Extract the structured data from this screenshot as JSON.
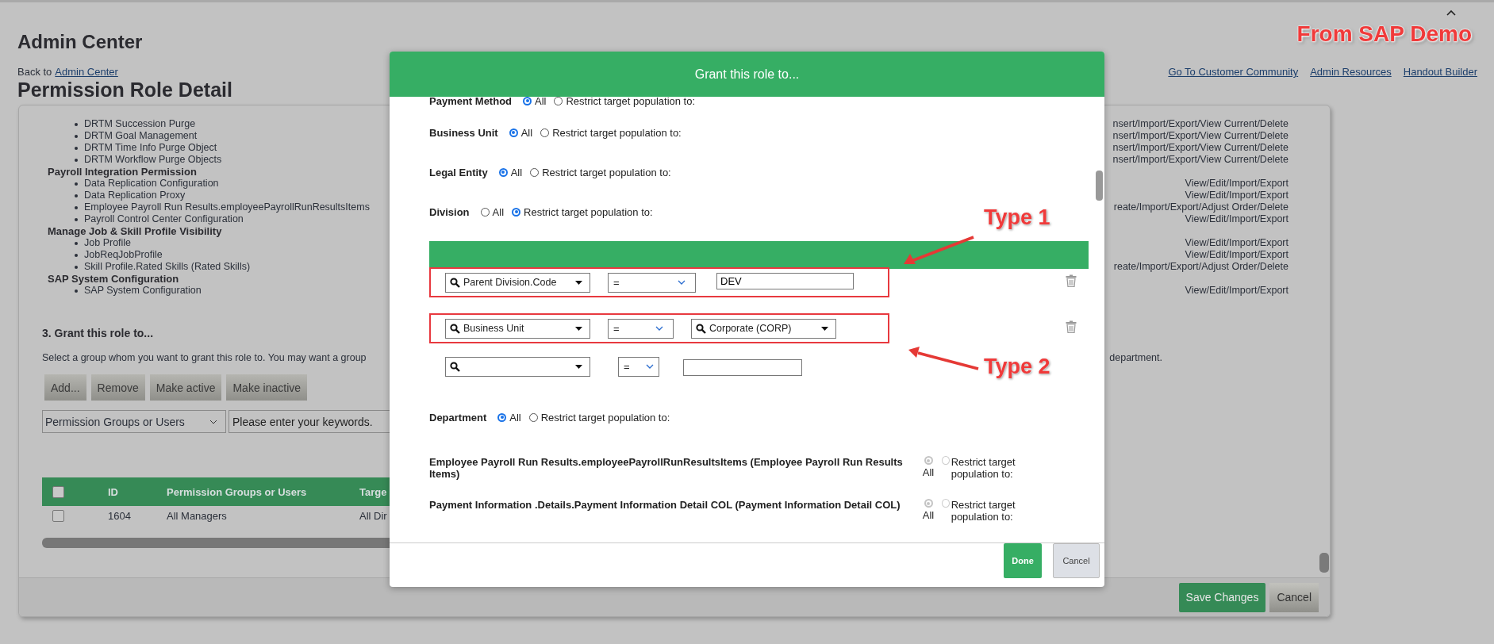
{
  "page": {
    "title": "Admin Center",
    "back_prefix": "Back to",
    "back_link": "Admin Center",
    "heading": "Permission Role Detail",
    "annotation": "From SAP Demo",
    "links": [
      "Go To Customer Community",
      "Admin Resources",
      "Handout Builder"
    ]
  },
  "permissions": [
    {
      "items": [
        {
          "name": "DRTM Succession Purge",
          "access": "nsert/Import/Export/View Current/Delete"
        },
        {
          "name": "DRTM Goal Management",
          "access": "nsert/Import/Export/View Current/Delete"
        },
        {
          "name": "DRTM Time Info Purge Object",
          "access": "nsert/Import/Export/View Current/Delete"
        },
        {
          "name": "DRTM Workflow Purge Objects",
          "access": "nsert/Import/Export/View Current/Delete"
        }
      ]
    },
    {
      "heading": "Payroll Integration Permission",
      "items": [
        {
          "name": "Data Replication Configuration",
          "access": "View/Edit/Import/Export"
        },
        {
          "name": "Data Replication Proxy",
          "access": "View/Edit/Import/Export"
        },
        {
          "name": "Employee Payroll Run Results.employeePayrollRunResultsItems",
          "access": "reate/Import/Export/Adjust Order/Delete"
        },
        {
          "name": "Payroll Control Center Configuration",
          "access": "View/Edit/Import/Export"
        }
      ]
    },
    {
      "heading": "Manage Job & Skill Profile Visibility",
      "items": [
        {
          "name": "Job Profile",
          "access": "View/Edit/Import/Export"
        },
        {
          "name": "JobReqJobProfile",
          "access": "View/Edit/Import/Export"
        },
        {
          "name": "Skill Profile.Rated Skills (Rated Skills)",
          "access": "reate/Import/Export/Adjust Order/Delete"
        }
      ]
    },
    {
      "heading": "SAP System Configuration",
      "items": [
        {
          "name": "SAP System Configuration",
          "access": "View/Edit/Import/Export"
        }
      ]
    }
  ],
  "grant": {
    "heading": "3. Grant this role to...",
    "description": "Select a group whom you want to grant this role to. You may want a group",
    "description_end": "department.",
    "buttons": [
      "Add...",
      "Remove",
      "Make active",
      "Make inactive"
    ],
    "filter_select": "Permission Groups or Users",
    "search": {
      "placeholder": "Please enter your keywords."
    },
    "table": {
      "header_checked": false,
      "columns": [
        "ID",
        "Permission Groups or Users",
        "Targe"
      ],
      "rows": [
        {
          "checked": false,
          "cells": [
            "1604",
            "All Managers",
            "All Dir"
          ]
        }
      ]
    }
  },
  "footer_buttons": [
    {
      "label": "Save Changes",
      "kind": "primary"
    },
    {
      "label": "Cancel",
      "kind": "secondary"
    }
  ],
  "modal": {
    "title": "Grant this role to...",
    "filters_before": [
      {
        "label": "Payment Method",
        "disabled": false,
        "options": [
          {
            "label": "All",
            "selected": true
          },
          {
            "label": "Restrict target population to:",
            "selected": false
          }
        ]
      },
      {
        "label": "Business Unit",
        "disabled": false,
        "options": [
          {
            "label": "All",
            "selected": true
          },
          {
            "label": "Restrict target population to:",
            "selected": false
          }
        ]
      },
      {
        "label": "Legal Entity",
        "disabled": false,
        "options": [
          {
            "label": "All",
            "selected": true
          },
          {
            "label": "Restrict target population to:",
            "selected": false
          }
        ]
      },
      {
        "label": "Division",
        "disabled": false,
        "options": [
          {
            "label": "All",
            "selected": false
          },
          {
            "label": "Restrict target population to:",
            "selected": true
          }
        ]
      }
    ],
    "rules": [
      {
        "field": "Parent Division.Code",
        "operator": "=",
        "kind": "text",
        "value": "DEV",
        "highlighted": true,
        "deletable": true,
        "annotation": {
          "label": "Type 1",
          "kind": "above"
        }
      },
      {
        "field": "Business Unit",
        "operator": "=",
        "kind": "select",
        "value": "Corporate (CORP)",
        "highlighted": true,
        "deletable": true,
        "annotation": {
          "label": "Type 2",
          "kind": "below"
        }
      },
      {
        "operator": "=",
        "kind": "text",
        "highlighted": false,
        "deletable": false
      }
    ],
    "filters_after": [
      {
        "label": "Department",
        "disabled": false,
        "options": [
          {
            "label": "All",
            "selected": true
          },
          {
            "label": "Restrict target population to:",
            "selected": false
          }
        ]
      },
      {
        "label": "Employee Payroll Run Results.employeePayrollRunResultsItems (Employee Payroll Run Results Items)",
        "disabled": true,
        "options": [
          {
            "label": "All",
            "selected": true
          },
          {
            "label": "Restrict target population to:",
            "selected": false
          }
        ]
      },
      {
        "label": "Payment Information .Details.Payment Information Detail COL (Payment Information Detail COL)",
        "disabled": true,
        "options": [
          {
            "label": "All",
            "selected": true
          },
          {
            "label": "Restrict target population to:",
            "selected": false
          }
        ]
      }
    ],
    "buttons": [
      {
        "label": "Done",
        "kind": "primary"
      },
      {
        "label": "Cancel",
        "kind": "secondary"
      }
    ]
  }
}
